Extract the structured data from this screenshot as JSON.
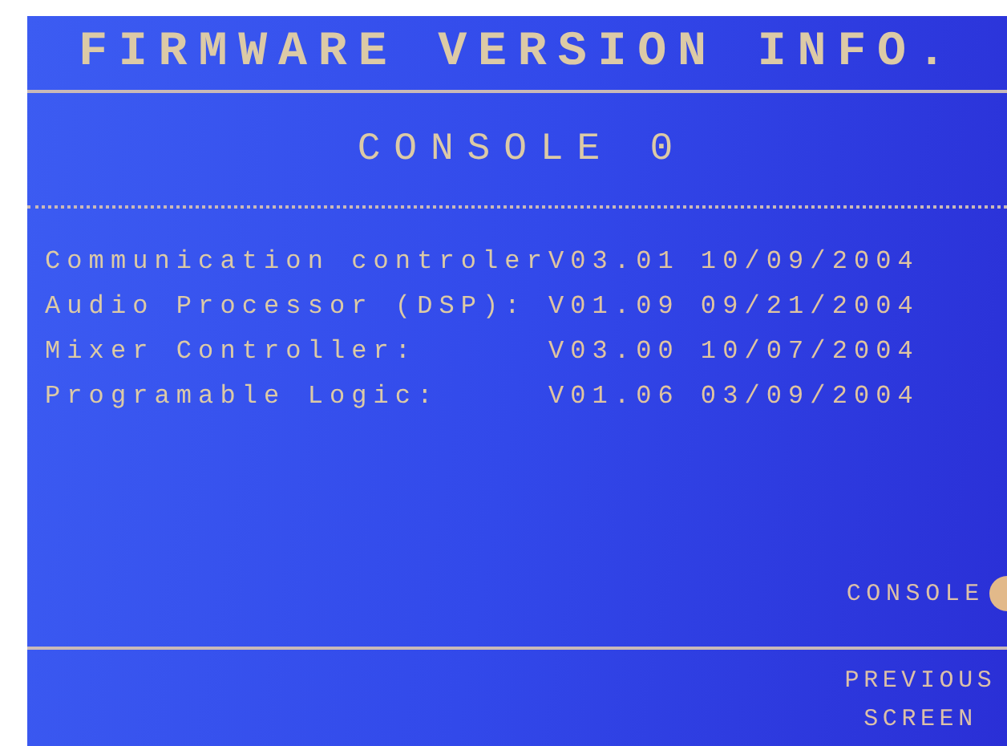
{
  "title": "FIRMWARE VERSION INFO.",
  "subtitle": "CONSOLE 0",
  "firmware": [
    {
      "label": "Communication controler",
      "version": "V03.01",
      "date": "10/09/2004"
    },
    {
      "label": "Audio Processor (DSP):",
      "version": "V01.09",
      "date": "09/21/2004"
    },
    {
      "label": "Mixer Controller:",
      "version": "V03.00",
      "date": "10/07/2004"
    },
    {
      "label": "Programable Logic:",
      "version": "V01.06",
      "date": "03/09/2004"
    }
  ],
  "console_key": {
    "label": "CONSOLE"
  },
  "previous_key": {
    "label": "PREVIOUS SCREEN"
  }
}
